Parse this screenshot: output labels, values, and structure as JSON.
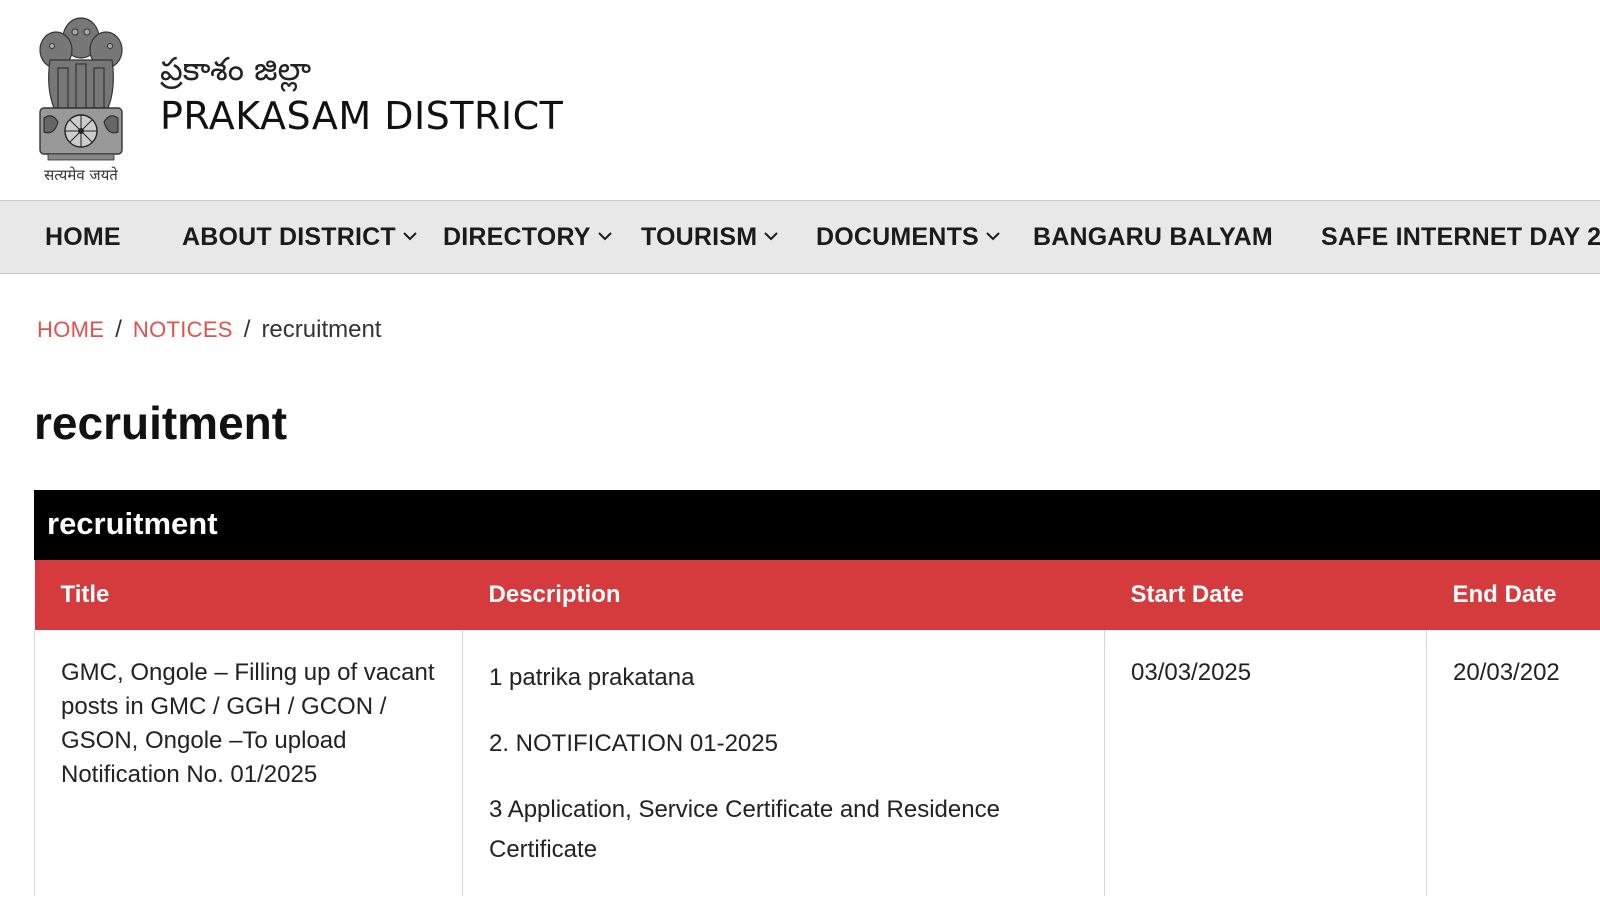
{
  "header": {
    "site_name_local": "ప్రకాశం జిల్లా",
    "site_name": "PRAKASAM DISTRICT",
    "emblem_motto": "सत्यमेव जयते"
  },
  "nav": {
    "items": [
      {
        "label": "HOME",
        "has_dropdown": false
      },
      {
        "label": "ABOUT DISTRICT",
        "has_dropdown": true
      },
      {
        "label": "DIRECTORY",
        "has_dropdown": true
      },
      {
        "label": "TOURISM",
        "has_dropdown": true
      },
      {
        "label": "DOCUMENTS",
        "has_dropdown": true
      },
      {
        "label": "BANGARU BALYAM",
        "has_dropdown": false
      },
      {
        "label": "SAFE INTERNET DAY 2",
        "has_dropdown": false
      }
    ]
  },
  "breadcrumb": {
    "home": "HOME",
    "notices": "NOTICES",
    "current": "recruitment",
    "separator": "/"
  },
  "page_title": "recruitment",
  "table": {
    "caption": "recruitment",
    "headers": [
      "Title",
      "Description",
      "Start Date",
      "End Date"
    ],
    "rows": [
      {
        "title": "GMC, Ongole – Filling up of vacant posts in GMC / GGH / GCON / GSON, Ongole –To upload Notification No. 01/2025",
        "description": [
          "1 patrika prakatana",
          "2. NOTIFICATION 01-2025",
          "3 Application, Service Certificate and Residence Certificate"
        ],
        "start_date": "03/03/2025",
        "end_date": "20/03/202"
      }
    ]
  },
  "colors": {
    "nav_bg": "#e8e8e8",
    "caption_bg": "#000000",
    "header_row_bg": "#d53a3c",
    "breadcrumb_link": "#e0524a"
  }
}
